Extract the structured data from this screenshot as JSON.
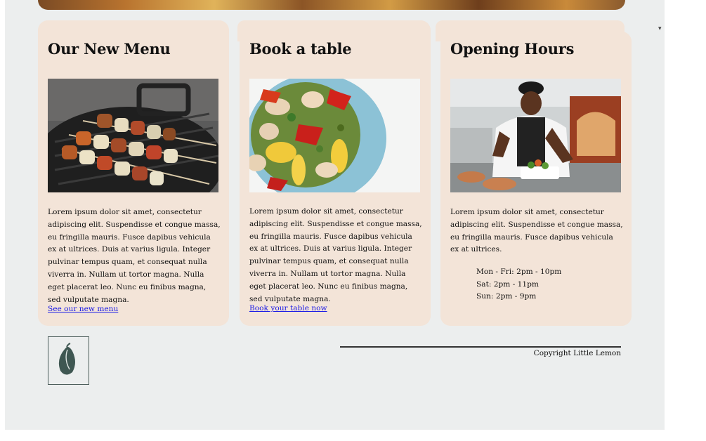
{
  "cards": [
    {
      "title": "Our New Menu",
      "body": "Lorem ipsum dolor sit amet, consectetur adipiscing elit. Suspendisse et congue massa, eu fringilla mauris. Fusce dapibus vehicula ex at ultrices. Duis at varius ligula. Integer pulvinar tempus quam, et consequat nulla viverra in. Nullam ut tortor magna. Nulla eget placerat leo. Nunc eu finibus magna, sed vulputate magna.",
      "link": "See our new menu",
      "image_icon": "grilled-skewers-photo"
    },
    {
      "title": "Book a table",
      "body": "Lorem ipsum dolor sit amet, consectetur adipiscing elit. Suspendisse et congue massa, eu fringilla mauris. Fusce dapibus vehicula ex at ultrices. Duis at varius ligula. Integer pulvinar tempus quam, et consequat nulla viverra in. Nullam ut tortor magna. Nulla eget placerat leo. Nunc eu finibus magna, sed vulputate magna.",
      "link": "Book your table now",
      "image_icon": "salad-plate-photo"
    },
    {
      "title": "Opening Hours",
      "body": "Lorem ipsum dolor sit amet, consectetur adipiscing elit. Suspendisse et congue massa, eu fringilla mauris. Fusce dapibus vehicula ex at ultrices.",
      "hours": [
        "Mon - Fri: 2pm - 10pm",
        "Sat: 2pm - 11pm",
        "Sun: 2pm - 9pm"
      ],
      "image_icon": "chef-cooking-photo"
    }
  ],
  "footer": {
    "copyright": "Copyright Little Lemon",
    "logo_icon": "lemon-leaf-logo"
  },
  "colors": {
    "card_bg": "#f3e4d8",
    "page_bg": "#eceeee",
    "link": "#1a1ae6",
    "logo": "#4d5e5b"
  }
}
